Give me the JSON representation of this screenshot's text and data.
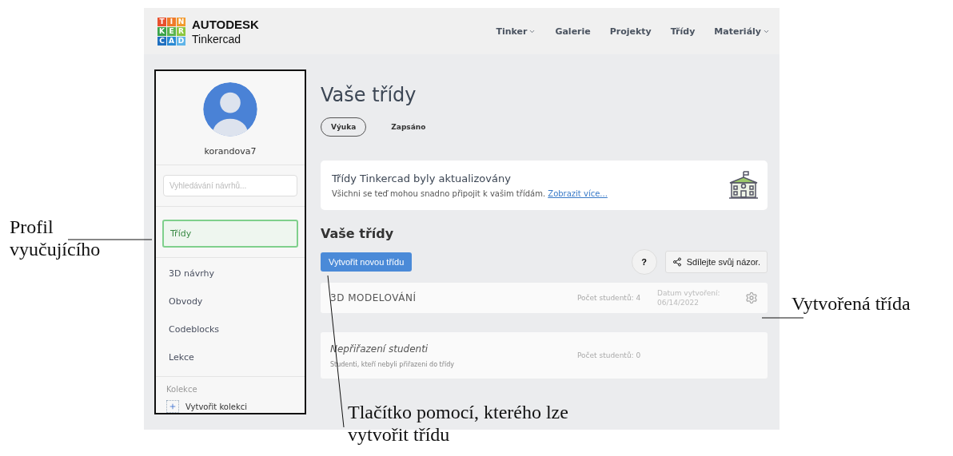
{
  "logo": {
    "tiles": [
      {
        "letter": "T",
        "color": "#e8502e"
      },
      {
        "letter": "I",
        "color": "#f07a2a"
      },
      {
        "letter": "N",
        "color": "#f29a2e"
      },
      {
        "letter": "K",
        "color": "#3aa34a"
      },
      {
        "letter": "E",
        "color": "#5bb450"
      },
      {
        "letter": "R",
        "color": "#8cc63f"
      },
      {
        "letter": "C",
        "color": "#1f6fc0"
      },
      {
        "letter": "A",
        "color": "#2a8ad4"
      },
      {
        "letter": "D",
        "color": "#5fb4e8"
      }
    ],
    "brand": "AUTODESK",
    "product": "Tinkercad"
  },
  "nav": [
    {
      "label": "Tinker",
      "dropdown": true
    },
    {
      "label": "Galerie",
      "dropdown": false
    },
    {
      "label": "Projekty",
      "dropdown": false
    },
    {
      "label": "Třídy",
      "dropdown": false
    },
    {
      "label": "Materiály",
      "dropdown": true
    }
  ],
  "sidebar": {
    "username": "korandova7",
    "search": {
      "placeholder": "Vyhledávání návrhů..."
    },
    "items": [
      {
        "label": "Třídy",
        "selected": true
      },
      {
        "label": "3D návrhy",
        "selected": false
      },
      {
        "label": "Obvody",
        "selected": false
      },
      {
        "label": "Codeblocks",
        "selected": false
      },
      {
        "label": "Lekce",
        "selected": false
      }
    ],
    "collections_heading": "Kolekce",
    "create_collection": "Vytvořit kolekci"
  },
  "main": {
    "title": "Vaše třídy",
    "tabs": [
      {
        "label": "Výuka",
        "selected": true
      },
      {
        "label": "Zapsáno",
        "selected": false
      }
    ],
    "notice": {
      "title": "Třídy Tinkercad byly aktualizovány",
      "text": "Všichni se teď mohou snadno připojit k vašim třídám.",
      "link": "Zobrazit více..."
    },
    "section_title": "Vaše třídy",
    "create_button": "Vytvořit novou třídu",
    "help_button": "?",
    "feedback_button": "Sdílejte svůj názor.",
    "classes": [
      {
        "kind": "class",
        "name": "3D MODELOVÁNÍ",
        "count": "Počet studentů: 4",
        "date_label": "Datum vytvoření:",
        "date": "06/14/2022"
      },
      {
        "kind": "unassigned",
        "name": "Nepřiřazení studenti",
        "subtitle": "Studenti, kteří nebyli přiřazeni do třídy",
        "count": "Počet studentů: 0"
      }
    ]
  },
  "annotations": {
    "profile": "Profil\nvyučujícího",
    "created_class": "Vytvořená třída",
    "create_button": "Tlačítko pomocí, kterého lze\nvytvořit třídu"
  }
}
